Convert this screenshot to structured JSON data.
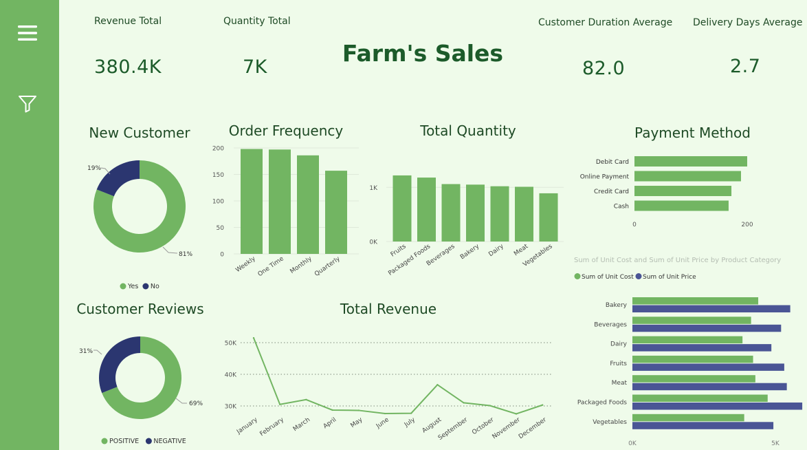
{
  "sidebar": {
    "menu_icon": "hamburger-menu-icon",
    "filter_icon": "filter-icon"
  },
  "title": "Farm's Sales",
  "kpis": {
    "revenue": {
      "label": "Revenue Total",
      "value": "380.4K"
    },
    "quantity": {
      "label": "Quantity Total",
      "value": "7K"
    },
    "duration": {
      "label": "Customer Duration Average",
      "value": "82.0"
    },
    "delivery": {
      "label": "Delivery Days Average",
      "value": "2.7"
    }
  },
  "colors": {
    "green": "#72b562",
    "navy": "#2b3670",
    "navy_light": "#4a5595",
    "bg": "#effbea",
    "text": "#1c5b2a"
  },
  "chart_data": [
    {
      "id": "new_customer",
      "type": "pie",
      "title": "New Customer",
      "labels": [
        "Yes",
        "No"
      ],
      "values": [
        81,
        19
      ],
      "data_labels": [
        "81%",
        "19%"
      ],
      "colors": [
        "#72b562",
        "#2b3670"
      ],
      "legend": "bottom"
    },
    {
      "id": "order_frequency",
      "type": "bar",
      "title": "Order Frequency",
      "categories": [
        "Weekly",
        "One Time",
        "Monthly",
        "Quarterly"
      ],
      "values": [
        198,
        197,
        186,
        157
      ],
      "yticks": [
        "0",
        "50",
        "100",
        "150",
        "200"
      ],
      "ylim": [
        0,
        200
      ]
    },
    {
      "id": "total_quantity",
      "type": "bar",
      "title": "Total Quantity",
      "categories": [
        "Fruits",
        "Packaged Foods",
        "Beverages",
        "Bakery",
        "Dairy",
        "Meat",
        "Vegetables"
      ],
      "values": [
        1220,
        1180,
        1060,
        1050,
        1020,
        1010,
        890
      ],
      "yticks": [
        "0K",
        "1K"
      ],
      "ylim": [
        0,
        1600
      ]
    },
    {
      "id": "payment_method",
      "type": "bar",
      "orientation": "horizontal",
      "title": "Payment Method",
      "categories": [
        "Debit Card",
        "Online Payment",
        "Credit Card",
        "Cash"
      ],
      "values": [
        200,
        189,
        172,
        167
      ],
      "xticks": [
        "0",
        "200"
      ],
      "xlim": [
        0,
        200
      ]
    },
    {
      "id": "customer_reviews",
      "type": "pie",
      "title": "Customer Reviews",
      "labels": [
        "POSITIVE",
        "NEGATIVE"
      ],
      "values": [
        69,
        31
      ],
      "data_labels": [
        "69%",
        "31%"
      ],
      "colors": [
        "#72b562",
        "#2b3670"
      ],
      "legend": "bottom"
    },
    {
      "id": "total_revenue",
      "type": "line",
      "title": "Total Revenue",
      "x": [
        "January",
        "February",
        "March",
        "April",
        "May",
        "June",
        "July",
        "August",
        "September",
        "October",
        "November",
        "December"
      ],
      "values": [
        51500,
        30500,
        32000,
        28700,
        28600,
        27600,
        27700,
        36700,
        31000,
        30100,
        27500,
        30300
      ],
      "yticks": [
        "30K",
        "40K",
        "50K"
      ],
      "ylim": [
        25000,
        53000
      ],
      "grid": true
    },
    {
      "id": "cost_price",
      "type": "bar",
      "orientation": "horizontal",
      "title": "Sum of Unit Cost and Sum of Unit Price by Product Category",
      "categories": [
        "Bakery",
        "Beverages",
        "Dairy",
        "Fruits",
        "Meat",
        "Packaged Foods",
        "Vegetables"
      ],
      "series": [
        {
          "name": "Sum of Unit Cost",
          "values": [
            4400,
            4150,
            3850,
            4220,
            4300,
            4730,
            3910
          ],
          "color": "#72b562"
        },
        {
          "name": "Sum of Unit Price",
          "values": [
            5520,
            5200,
            4860,
            5310,
            5400,
            5940,
            4930
          ],
          "color": "#4a5595"
        }
      ],
      "xticks": [
        "0K",
        "5K"
      ],
      "xlim": [
        0,
        6000
      ],
      "legend": "top-left"
    }
  ]
}
